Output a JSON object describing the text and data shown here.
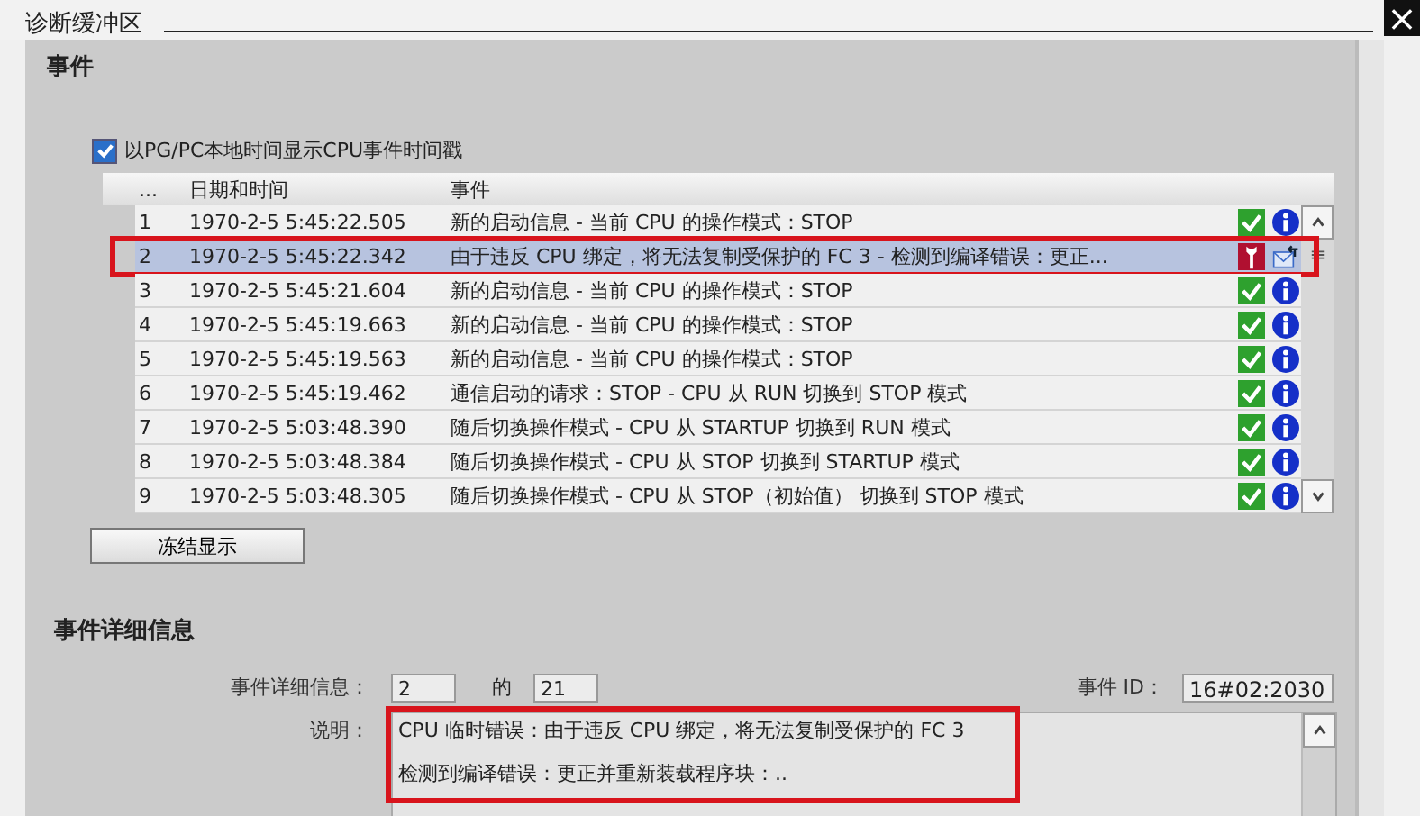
{
  "window": {
    "title": "诊断缓冲区",
    "close": "×"
  },
  "events_section": {
    "heading": "事件",
    "timestamp_option": {
      "label": "以PG/PC本地时间显示CPU事件时间戳",
      "checked": true
    }
  },
  "table": {
    "columns": [
      "...",
      "日期和时间",
      "事件"
    ],
    "rows": [
      {
        "no": "1",
        "datetime": "1970-2-5 5:45:22.505",
        "event": "新的启动信息 - 当前 CPU 的操作模式：STOP",
        "kind": "info",
        "selected": false,
        "marked": false
      },
      {
        "no": "2",
        "datetime": "1970-2-5 5:45:22.342",
        "event": "由于违反 CPU 绑定，将无法复制受保护的 FC 3 - 检测到编译错误：更正...",
        "kind": "fault",
        "selected": true,
        "marked": true
      },
      {
        "no": "3",
        "datetime": "1970-2-5 5:45:21.604",
        "event": "新的启动信息 - 当前 CPU 的操作模式：STOP",
        "kind": "info",
        "selected": false,
        "marked": false
      },
      {
        "no": "4",
        "datetime": "1970-2-5 5:45:19.663",
        "event": "新的启动信息 - 当前 CPU 的操作模式：STOP",
        "kind": "info",
        "selected": false,
        "marked": false
      },
      {
        "no": "5",
        "datetime": "1970-2-5 5:45:19.563",
        "event": "新的启动信息 - 当前 CPU 的操作模式：STOP",
        "kind": "info",
        "selected": false,
        "marked": false
      },
      {
        "no": "6",
        "datetime": "1970-2-5 5:45:19.462",
        "event": "通信启动的请求：STOP - CPU 从 RUN 切换到 STOP 模式",
        "kind": "info",
        "selected": false,
        "marked": false
      },
      {
        "no": "7",
        "datetime": "1970-2-5 5:03:48.390",
        "event": "随后切换操作模式 - CPU 从 STARTUP 切换到 RUN 模式",
        "kind": "info",
        "selected": false,
        "marked": false
      },
      {
        "no": "8",
        "datetime": "1970-2-5 5:03:48.384",
        "event": "随后切换操作模式 - CPU 从 STOP 切换到 STARTUP 模式",
        "kind": "info",
        "selected": false,
        "marked": false
      },
      {
        "no": "9",
        "datetime": "1970-2-5 5:03:48.305",
        "event": "随后切换操作模式 - CPU 从 STOP（初始值） 切换到 STOP 模式",
        "kind": "info",
        "selected": false,
        "marked": false
      }
    ]
  },
  "freeze_button": "冻结显示",
  "details": {
    "heading": "事件详细信息",
    "index_label": "事件详细信息：",
    "index": "2",
    "of_label": "的",
    "total": "21",
    "id_label": "事件 ID：",
    "id": "16#02:2030",
    "description_label": "说明：",
    "description": [
      "CPU 临时错误：由于违反 CPU 绑定，将无法复制受保护的 FC 3",
      "检测到编译错误：更正并重新装载程序块：.."
    ],
    "description_marked": true
  }
}
